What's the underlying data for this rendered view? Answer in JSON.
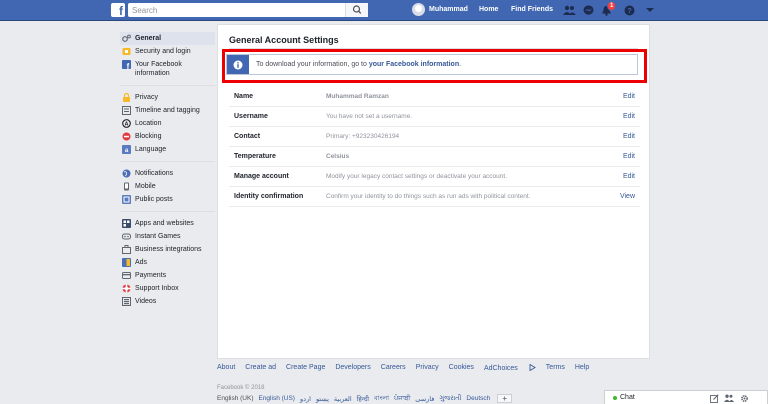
{
  "topbar": {
    "logo_letter": "f",
    "search_placeholder": "Search",
    "user_name": "Muhammad",
    "home": "Home",
    "find_friends": "Find Friends",
    "notification_count": "1",
    "icons": [
      "friend-requests-icon",
      "messenger-icon",
      "notifications-icon",
      "help-icon",
      "account-menu-icon"
    ]
  },
  "sidebar": {
    "groups": [
      [
        {
          "label": "General",
          "icon": "gear-icon"
        },
        {
          "label": "Security and login",
          "icon": "shield-icon"
        },
        {
          "label": "Your Facebook information",
          "icon": "facebook-icon"
        }
      ],
      [
        {
          "label": "Privacy",
          "icon": "privacy-icon"
        },
        {
          "label": "Timeline and tagging",
          "icon": "timeline-icon"
        },
        {
          "label": "Location",
          "icon": "location-icon"
        },
        {
          "label": "Blocking",
          "icon": "blocking-icon"
        },
        {
          "label": "Language",
          "icon": "language-icon"
        }
      ],
      [
        {
          "label": "Notifications",
          "icon": "globe-icon"
        },
        {
          "label": "Mobile",
          "icon": "mobile-icon"
        },
        {
          "label": "Public posts",
          "icon": "public-posts-icon"
        }
      ],
      [
        {
          "label": "Apps and websites",
          "icon": "apps-icon"
        },
        {
          "label": "Instant Games",
          "icon": "games-icon"
        },
        {
          "label": "Business integrations",
          "icon": "business-icon"
        },
        {
          "label": "Ads",
          "icon": "ads-icon"
        },
        {
          "label": "Payments",
          "icon": "payments-icon"
        },
        {
          "label": "Support Inbox",
          "icon": "support-icon"
        },
        {
          "label": "Videos",
          "icon": "videos-icon"
        }
      ]
    ]
  },
  "main": {
    "title": "General Account Settings",
    "info": {
      "text": "To download your information, go to ",
      "link": "your Facebook information",
      "tail": "."
    },
    "rows": [
      {
        "label": "Name",
        "value": "Muhammad Ramzan",
        "action": "Edit",
        "strong": true
      },
      {
        "label": "Username",
        "value": "You have not set a username.",
        "action": "Edit",
        "strong": false
      },
      {
        "label": "Contact",
        "value": "Primary: +923230426194",
        "action": "Edit",
        "strong": false
      },
      {
        "label": "Temperature",
        "value": "Celsius",
        "action": "Edit",
        "strong": true
      },
      {
        "label": "Manage account",
        "value": "Modify your legacy contact settings or deactivate your account.",
        "action": "Edit",
        "strong": false
      },
      {
        "label": "Identity confirmation",
        "value": "Confirm your identity to do things such as run ads with political content.",
        "action": "View",
        "strong": false
      }
    ]
  },
  "footer": {
    "links": [
      "About",
      "Create ad",
      "Create Page",
      "Developers",
      "Careers",
      "Privacy",
      "Cookies",
      "AdChoices",
      "Terms",
      "Help"
    ],
    "copyright": "Facebook © 2018",
    "languages": [
      "English (UK)",
      "English (US)",
      "اردو",
      "پښتو",
      "العربية",
      "हिन्दी",
      "বাংলা",
      "ਪੰਜਾਬੀ",
      "فارسی",
      "ગુજરાતી",
      "Deutsch"
    ],
    "current_language": "English (UK)",
    "add_language": "+"
  },
  "chat": {
    "label": "Chat",
    "status_color": "#42b72a"
  },
  "colors": {
    "brand": "#4267b2",
    "link": "#365899",
    "highlight_border": "#ee0000"
  }
}
